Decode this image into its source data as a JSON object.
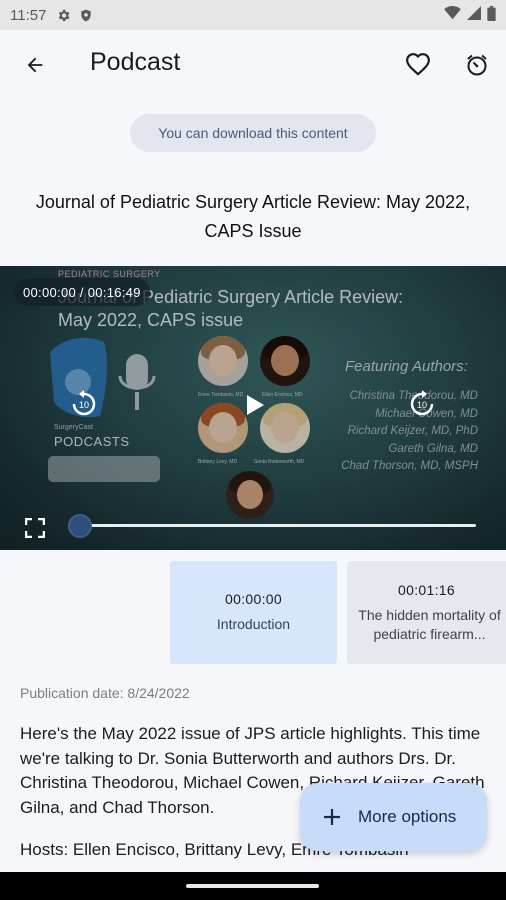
{
  "status_bar": {
    "time": "11:57",
    "icons": [
      "settings-icon",
      "shield-icon",
      "wifi-icon",
      "signal-icon",
      "battery-icon"
    ]
  },
  "app_bar": {
    "title": "Podcast",
    "icons": [
      "back-arrow-icon",
      "heart-icon",
      "timer-icon"
    ]
  },
  "download_chip": "You can download this content",
  "episode": {
    "title": "Journal of Pediatric Surgery Article Review: May 2022, CAPS Issue",
    "publication_date": "Publication date: 8/24/2022",
    "description": "Here's the May 2022 issue of JPS article highlights. This time we're talking to Dr. Sonia Butterworth and authors Drs. Dr. Christina Theodorou, Michael Cowen, Richard Keijzer, Gareth Gilna, and Chad Thorson.",
    "hosts": "Hosts: Ellen Encisco, Brittany Levy, Emre Tombasin"
  },
  "player": {
    "time_display": "00:00:00 / 00:16:49",
    "progress": 0.0,
    "artwork": {
      "brand": "PEDIATRIC SURGERY",
      "title_line1": "Journal of Pediatric Surgery Article Review:",
      "title_line2": "May 2022, CAPS issue",
      "featuring": "Featuring Authors:",
      "authors": [
        "Christina Theodorou, MD",
        "Michael Cowen, MD",
        "Richard Keijzer, MD, PhD",
        "Gareth Gilna, MD",
        "Chad Thorson, MD, MSPH"
      ],
      "podcasts_small": "SurgeryCast",
      "podcasts": "PODCASTS",
      "avatar_captions": [
        "Emre Tombasin, MD",
        "Ellen Encisco, MD",
        "Brittany Levy, MD",
        "Sonia Butterworth, MD"
      ]
    },
    "skip_back_seconds": "10",
    "skip_forward_seconds": "10",
    "icons": [
      "play-icon",
      "replay-10-icon",
      "forward-10-icon",
      "fullscreen-icon"
    ]
  },
  "chapters": [
    {
      "time": "00:00:00",
      "label": "Introduction",
      "active": true
    },
    {
      "time": "00:01:16",
      "label": "The hidden mortality of pediatric firearm...",
      "active": false
    }
  ],
  "fab": {
    "label": "More options",
    "icon": "plus-icon"
  },
  "colors": {
    "background": "#f6f7fb",
    "chip": "#e3e6ef",
    "chapter_active": "#d6e6fc",
    "chapter_inactive": "#e6e8ee",
    "fab": "#c6dcf8",
    "seek_thumb": "#2e4d79"
  }
}
